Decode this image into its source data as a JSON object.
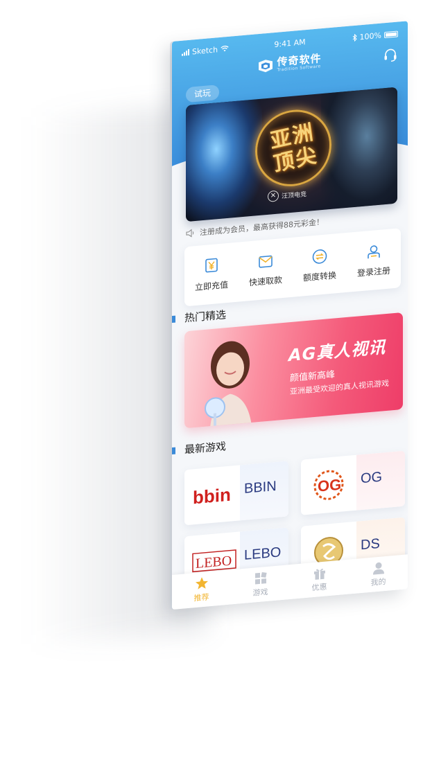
{
  "status_bar": {
    "carrier": "Sketch",
    "time": "9:41 AM",
    "battery": "100%"
  },
  "header": {
    "app_name": "传奇软件",
    "app_subtitle": "Tradition Software"
  },
  "trial_button": "试玩",
  "banner": {
    "title_line1": "亚洲",
    "title_line2": "顶尖",
    "badge_text": "汪顶电竞"
  },
  "notice": "注册成为会员，最高获得88元彩金！",
  "quick_actions": [
    {
      "label": "立即充值",
      "icon": "yuan-card-icon"
    },
    {
      "label": "快速取款",
      "icon": "withdraw-envelope-icon"
    },
    {
      "label": "额度转换",
      "icon": "exchange-icon"
    },
    {
      "label": "登录注册",
      "icon": "user-login-icon"
    }
  ],
  "hot_section": {
    "title": "热门精选",
    "promo": {
      "heading": "AG真人视讯",
      "line1": "颜值新高峰",
      "line2": "亚洲最受欢迎的真人视讯游戏"
    }
  },
  "latest_section": {
    "title": "最新游戏",
    "games": [
      {
        "logo_text": "bbin",
        "name": "BBIN"
      },
      {
        "logo_text": "OG",
        "name": "OG"
      },
      {
        "logo_text": "LEBO",
        "name": "LEBO"
      },
      {
        "logo_text": "DS",
        "name": "DS"
      }
    ]
  },
  "tabs": [
    {
      "label": "推荐",
      "icon": "star-icon",
      "active": true
    },
    {
      "label": "游戏",
      "icon": "grid-icon",
      "active": false
    },
    {
      "label": "优惠",
      "icon": "gift-icon",
      "active": false
    },
    {
      "label": "我的",
      "icon": "user-icon",
      "active": false
    }
  ],
  "colors": {
    "header_blue": "#3b8fdc",
    "accent_gold": "#f2b531",
    "promo_pink": "#f45a7a",
    "game_name_navy": "#2a3a80"
  }
}
